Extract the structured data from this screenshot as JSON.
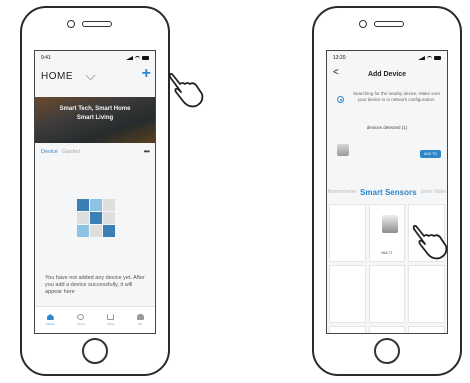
{
  "left_phone": {
    "status_time": "9:41",
    "home_title": "HOME",
    "add_symbol": "+",
    "banner_line1": "Smart Tech, Smart Home",
    "banner_line2": "Smart Living",
    "tabs": [
      {
        "label": "Device",
        "active": true
      },
      {
        "label": "Garden",
        "active": false
      }
    ],
    "more": "•••",
    "empty_message": "You have not added any device yet. After you add a device successfully, it will appear here",
    "nav": [
      {
        "label": "Home",
        "icon": "home-icon",
        "active": true
      },
      {
        "label": "Smart",
        "icon": "smart-icon",
        "active": false
      },
      {
        "label": "Shop",
        "icon": "cart-icon",
        "active": false
      },
      {
        "label": "Me",
        "icon": "person-icon",
        "active": false
      }
    ]
  },
  "right_phone": {
    "status_time": "13:20",
    "back": "<",
    "title": "Add Device",
    "search_text": "Searching for the nearby device. Make sure your device is in network configuration.",
    "detected_text": "devices detected (1)",
    "add_button": "ADD TO",
    "categories": [
      "thermometer",
      "Smart Sensors",
      "Siren Video"
    ],
    "sensor_label": "IAM-T1"
  },
  "colors": {
    "accent": "#2f86c9",
    "tile_dark": "#3b7fb4",
    "tile_light": "#8fc3e3",
    "tile_grey": "#dedede"
  },
  "grid_tiles": [
    "dark",
    "light",
    "grey",
    "grey",
    "dark",
    "grey",
    "light",
    "grey",
    "dark"
  ]
}
